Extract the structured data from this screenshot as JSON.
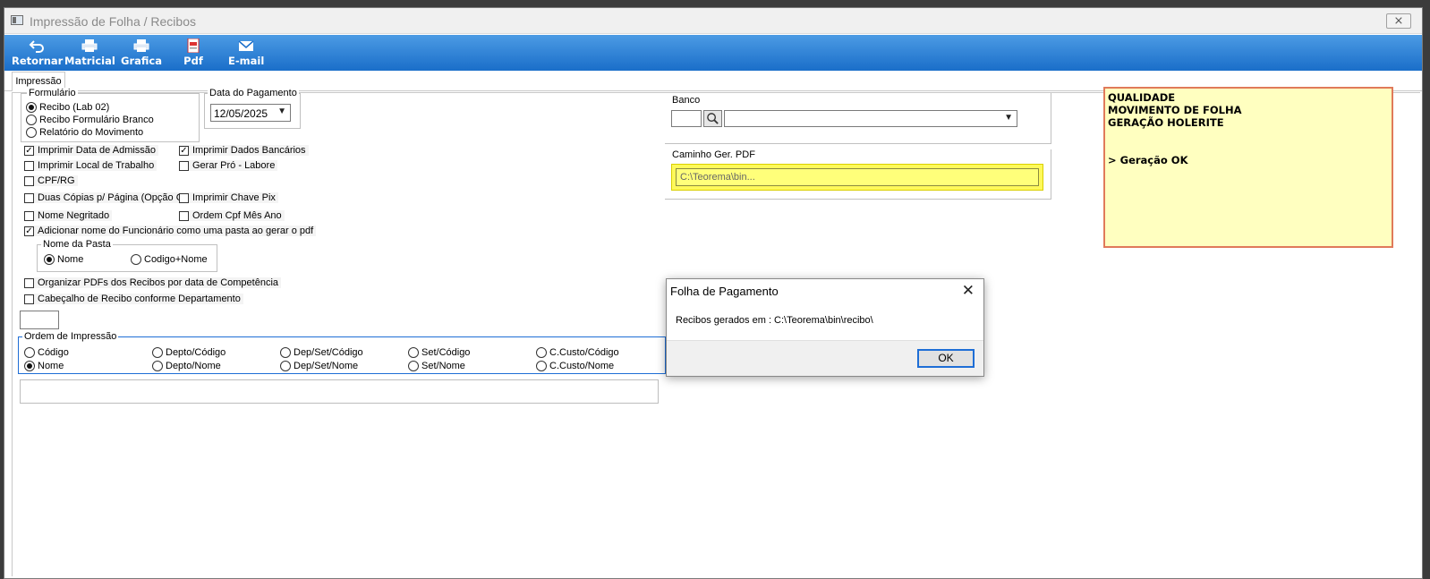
{
  "window": {
    "title": "Impressão de Folha / Recibos",
    "close_glyph": "⨯"
  },
  "toolbar": {
    "buttons": [
      {
        "label": "Retornar",
        "icon": "return-arrow-icon"
      },
      {
        "label": "Matricial",
        "icon": "printer-icon"
      },
      {
        "label": "Grafica",
        "icon": "printer-icon"
      },
      {
        "label": "Pdf",
        "icon": "pdf-icon"
      },
      {
        "label": "E-mail",
        "icon": "email-icon"
      }
    ]
  },
  "tabs": [
    {
      "label": "Impressão"
    }
  ],
  "formulario": {
    "title": "Formulário",
    "options": [
      {
        "label": "Recibo (Lab 02)",
        "selected": true
      },
      {
        "label": "Recibo Formulário Branco",
        "selected": false
      },
      {
        "label": "Relatório do Movimento",
        "selected": false
      }
    ]
  },
  "data_pagamento": {
    "title": "Data do Pagamento",
    "value": "12/05/2025"
  },
  "checks": {
    "imprimir_data_admissao": {
      "label": "Imprimir Data de Admissão",
      "checked": true
    },
    "imprimir_dados_bancarios": {
      "label": "Imprimir Dados Bancários",
      "checked": true
    },
    "imprimir_local_trabalho": {
      "label": "Imprimir Local de Trabalho",
      "checked": false
    },
    "gerar_pro_labore": {
      "label": "Gerar Pró - Labore",
      "checked": false
    },
    "cpf_rg": {
      "label": "CPF/RG",
      "checked": false
    },
    "duas_copias": {
      "label": "Duas Cópias p/ Página (Opção G",
      "checked": false
    },
    "imprimir_chave_pix": {
      "label": "Imprimir Chave Pix",
      "checked": false
    },
    "nome_negritado": {
      "label": "Nome Negritado",
      "checked": false
    },
    "ordem_cpf": {
      "label": "Ordem Cpf Mês Ano",
      "checked": false
    },
    "adicionar_nome": {
      "label": "Adicionar nome do Funcionário como uma pasta ao gerar o pdf",
      "checked": true
    },
    "organizar_pdfs": {
      "label": "Organizar PDFs dos Recibos por data de Competência",
      "checked": false
    },
    "cabecalho_recibo": {
      "label": "Cabeçalho de Recibo conforme Departamento",
      "checked": false
    }
  },
  "nome_pasta": {
    "title": "Nome da Pasta",
    "options": [
      {
        "label": "Nome",
        "selected": true
      },
      {
        "label": "Codigo+Nome",
        "selected": false
      }
    ]
  },
  "ordem_impressao": {
    "title": "Ordem de Impressão",
    "options": [
      {
        "label": "Código",
        "selected": false
      },
      {
        "label": "Depto/Código",
        "selected": false
      },
      {
        "label": "Dep/Set/Código",
        "selected": false
      },
      {
        "label": "Set/Código",
        "selected": false
      },
      {
        "label": "C.Custo/Código",
        "selected": false
      },
      {
        "label": "Nome",
        "selected": true
      },
      {
        "label": "Depto/Nome",
        "selected": false
      },
      {
        "label": "Dep/Set/Nome",
        "selected": false
      },
      {
        "label": "Set/Nome",
        "selected": false
      },
      {
        "label": "C.Custo/Nome",
        "selected": false
      }
    ]
  },
  "banco": {
    "label": "Banco",
    "code": "",
    "name": ""
  },
  "caminho_pdf": {
    "label": "Caminho Ger. PDF",
    "value": "C:\\Teorema\\bin..."
  },
  "status_note": {
    "lines": [
      "QUALIDADE",
      "MOVIMENTO DE FOLHA",
      "GERAÇÃO HOLERITE",
      "",
      "",
      "> Geração OK"
    ]
  },
  "dialog": {
    "title": "Folha de Pagamento",
    "close_glyph": "✕",
    "message": "Recibos gerados em : C:\\Teorema\\bin\\recibo\\",
    "ok_label": "OK"
  }
}
